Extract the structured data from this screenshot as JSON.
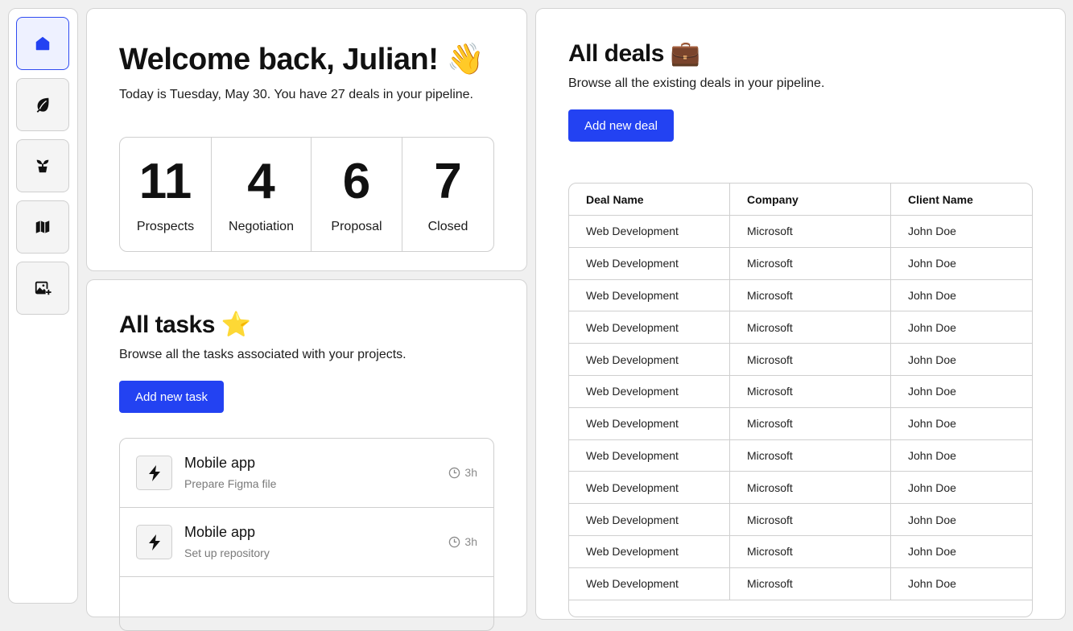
{
  "colors": {
    "accent": "#2342f2",
    "active_nav_bg": "#eef1ff",
    "border": "#cfcfcf",
    "page_bg": "#f0f0f0"
  },
  "sidebar": {
    "items": [
      {
        "icon": "home-icon",
        "active": true
      },
      {
        "icon": "leaf-icon",
        "active": false
      },
      {
        "icon": "plant-icon",
        "active": false
      },
      {
        "icon": "map-icon",
        "active": false
      },
      {
        "icon": "add-image-icon",
        "active": false
      }
    ]
  },
  "welcome": {
    "title": "Welcome back, Julian! 👋",
    "subtitle": "Today is Tuesday, May 30. You have 27 deals in your pipeline.",
    "stats": [
      {
        "value": "11",
        "label": "Prospects"
      },
      {
        "value": "4",
        "label": "Negotiation"
      },
      {
        "value": "6",
        "label": "Proposal"
      },
      {
        "value": "7",
        "label": "Closed"
      }
    ]
  },
  "tasks": {
    "title": "All tasks ⭐",
    "subtitle": "Browse all the tasks associated with your projects.",
    "add_label": "Add new task",
    "items": [
      {
        "title": "Mobile app",
        "subtitle": "Prepare Figma file",
        "time": "3h",
        "icon": "bolt-icon"
      },
      {
        "title": "Mobile app",
        "subtitle": "Set up repository",
        "time": "3h",
        "icon": "bolt-icon"
      }
    ]
  },
  "deals": {
    "title": "All deals 💼",
    "subtitle": "Browse all the existing deals in your pipeline.",
    "add_label": "Add new deal",
    "columns": [
      "Deal Name",
      "Company",
      "Client Name"
    ],
    "rows": [
      [
        "Web Development",
        "Microsoft",
        "John Doe"
      ],
      [
        "Web Development",
        "Microsoft",
        "John Doe"
      ],
      [
        "Web Development",
        "Microsoft",
        "John Doe"
      ],
      [
        "Web Development",
        "Microsoft",
        "John Doe"
      ],
      [
        "Web Development",
        "Microsoft",
        "John Doe"
      ],
      [
        "Web Development",
        "Microsoft",
        "John Doe"
      ],
      [
        "Web Development",
        "Microsoft",
        "John Doe"
      ],
      [
        "Web Development",
        "Microsoft",
        "John Doe"
      ],
      [
        "Web Development",
        "Microsoft",
        "John Doe"
      ],
      [
        "Web Development",
        "Microsoft",
        "John Doe"
      ],
      [
        "Web Development",
        "Microsoft",
        "John Doe"
      ],
      [
        "Web Development",
        "Microsoft",
        "John Doe"
      ]
    ]
  }
}
